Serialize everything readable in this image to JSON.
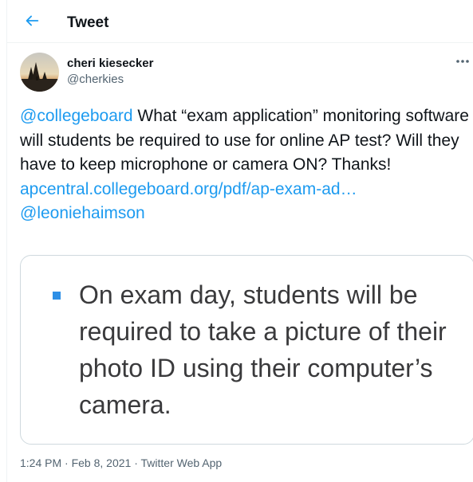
{
  "header": {
    "title": "Tweet",
    "back_icon": "back-arrow-icon",
    "accent_color": "#1d9bf0"
  },
  "tweet": {
    "author": {
      "display_name": "cheri kiesecker",
      "handle": "@cherkies"
    },
    "more_icon": "more-dots-icon",
    "body": {
      "mention": "@collegeboard",
      "text": " What “exam application” monitoring software will students be required to use for online AP test? Will they have to keep microphone or camera ON? Thanks!",
      "url": "apcentral.collegeboard.org/pdf/ap-exam-ad…",
      "mention2": "@leoniehaimson"
    },
    "media": {
      "caption_text": "On exam day, students will be required to take a picture of their photo ID using their computer’s camera."
    },
    "meta": {
      "time": "1:24 PM",
      "separator": " · ",
      "date": "Feb 8, 2021",
      "source": "Twitter Web App"
    }
  }
}
